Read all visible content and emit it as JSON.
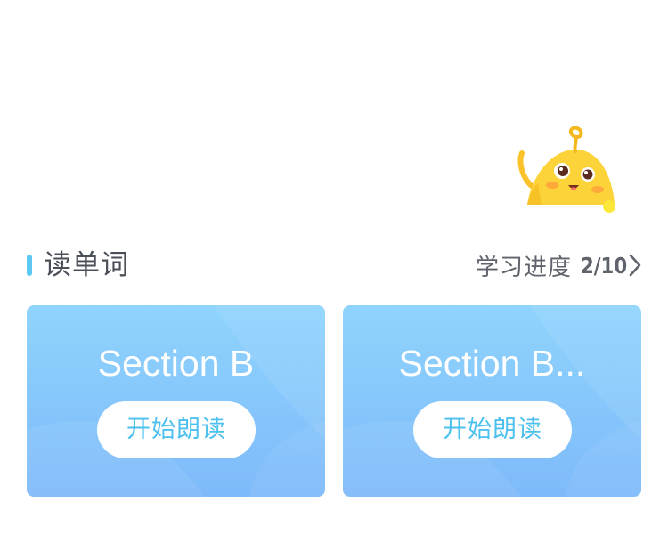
{
  "mascot": {
    "icon": "yellow-blob-mascot-icon"
  },
  "section": {
    "title": "读单词",
    "progress_label": "学习进度",
    "progress_value": "2/10",
    "accent_color": "#5cc8f4"
  },
  "cards": [
    {
      "title": "Section B",
      "button_label": "开始朗读"
    },
    {
      "title": "Section B...",
      "button_label": "开始朗读"
    }
  ],
  "colors": {
    "card_gradient_top": "#8fd4fd",
    "card_gradient_bottom": "#7ebafa",
    "button_text": "#4cc0ee",
    "mascot_body": "#fdd33a"
  }
}
